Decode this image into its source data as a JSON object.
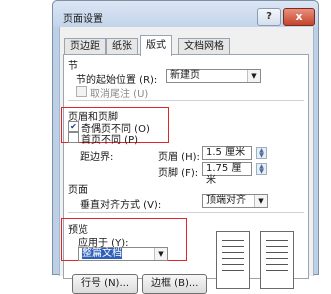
{
  "window": {
    "title": "页面设置",
    "help_label": "?",
    "close_label": "x"
  },
  "tabs": [
    {
      "label": "页边距"
    },
    {
      "label": "纸张"
    },
    {
      "label": "版式",
      "active": true
    },
    {
      "label": "文档网格"
    }
  ],
  "section": {
    "label": "节",
    "start_label": "节的起始位置 (R):",
    "start_value": "新建页",
    "suppress_endnotes_label": "取消尾注 (U)"
  },
  "header_footer": {
    "label": "页眉和页脚",
    "odd_even_label": "奇偶页不同 (O)",
    "odd_even_checked": true,
    "first_page_label": "首页不同 (P)",
    "first_page_checked": false,
    "from_edge_label": "距边界:",
    "header_label": "页眉 (H):",
    "header_value": "1.5 厘米",
    "footer_label": "页脚 (F):",
    "footer_value": "1.75 厘米"
  },
  "page": {
    "label": "页面",
    "valign_label": "垂直对齐方式 (V):",
    "valign_value": "顶端对齐"
  },
  "preview": {
    "label": "预览",
    "apply_label": "应用于 (Y):",
    "apply_value": "整篇文档"
  },
  "bottom_buttons": {
    "line_numbers": "行号 (N)...",
    "borders": "边框 (B)..."
  }
}
